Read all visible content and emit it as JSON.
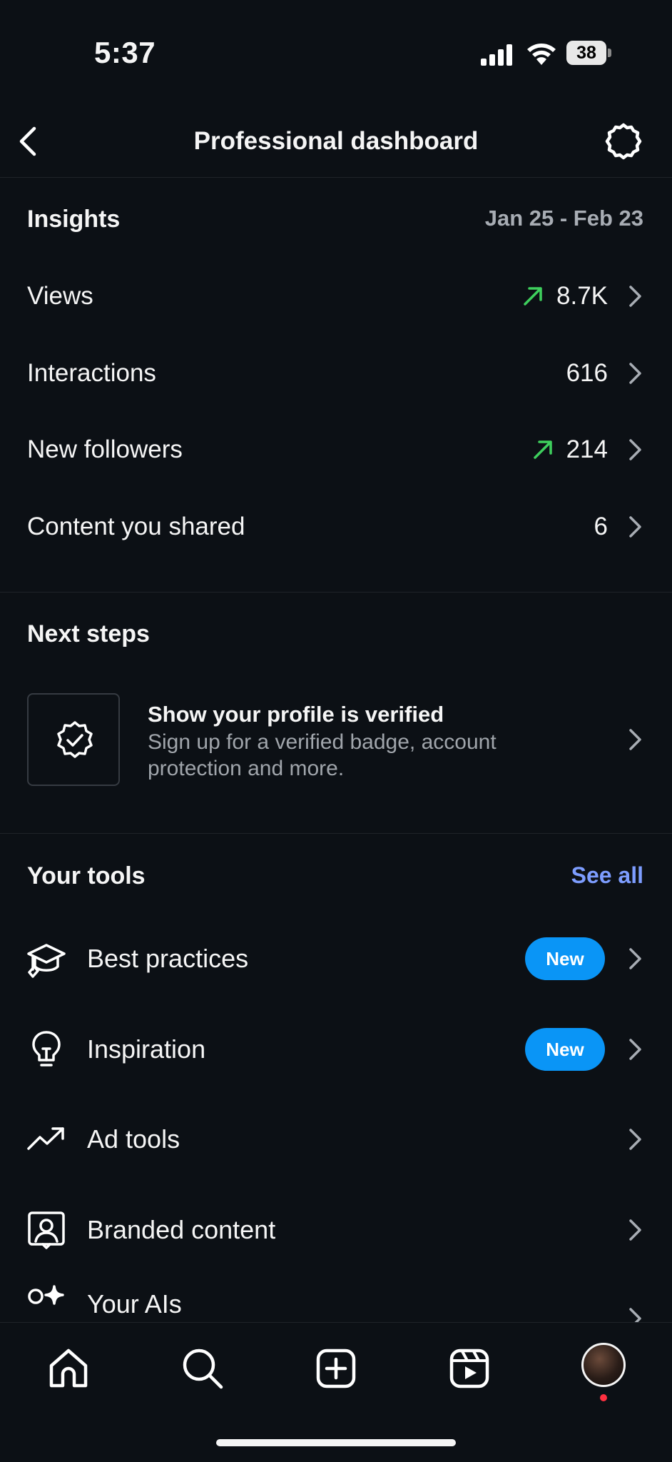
{
  "status_bar": {
    "time": "5:37",
    "battery": "38"
  },
  "header": {
    "title": "Professional dashboard"
  },
  "insights": {
    "title": "Insights",
    "date_range": "Jan 25 - Feb 23",
    "rows": [
      {
        "label": "Views",
        "value": "8.7K",
        "trend": "up"
      },
      {
        "label": "Interactions",
        "value": "616",
        "trend": "none"
      },
      {
        "label": "New followers",
        "value": "214",
        "trend": "up"
      },
      {
        "label": "Content you shared",
        "value": "6",
        "trend": "none"
      }
    ]
  },
  "next_steps": {
    "title": "Next steps",
    "card": {
      "title": "Show your profile is verified",
      "description": "Sign up for a verified badge, account protection and more."
    }
  },
  "tools": {
    "title": "Your tools",
    "see_all": "See all",
    "items": [
      {
        "label": "Best practices",
        "icon": "graduation-cap-icon",
        "badge": "New"
      },
      {
        "label": "Inspiration",
        "icon": "lightbulb-icon",
        "badge": "New"
      },
      {
        "label": "Ad tools",
        "icon": "trending-up-icon"
      },
      {
        "label": "Branded content",
        "icon": "branded-content-icon"
      },
      {
        "label": "Your AIs",
        "icon": "ai-sparkle-icon"
      }
    ]
  },
  "nav": {
    "items": [
      "home-icon",
      "search-icon",
      "create-icon",
      "reels-icon",
      "profile-avatar"
    ]
  },
  "colors": {
    "background": "#0c1015",
    "trend_up": "#3ecf5d",
    "badge": "#0a95f6",
    "link": "#7d9dff",
    "notification_dot": "#ff3040"
  }
}
